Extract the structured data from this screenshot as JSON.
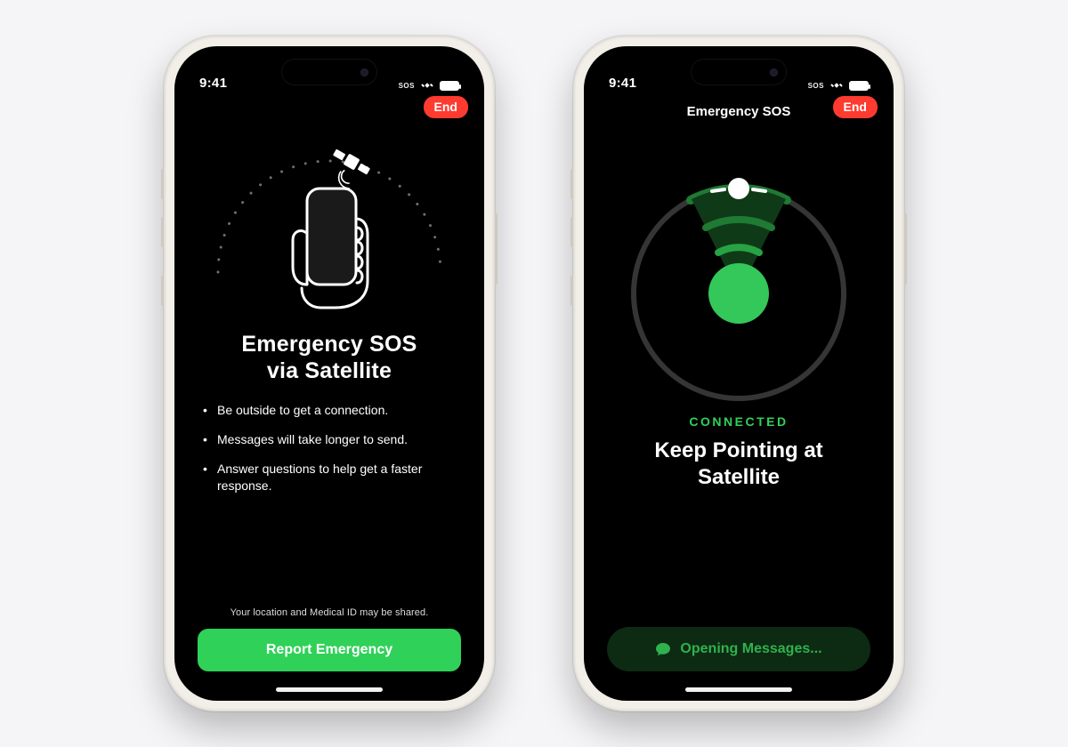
{
  "colors": {
    "accent_green": "#30d158",
    "danger_red": "#ff3b30",
    "pill_bg": "#0d2a13",
    "pill_fg": "#2fb24e"
  },
  "status_bar": {
    "time": "9:41",
    "sos_label": "SOS"
  },
  "screen1": {
    "end_label": "End",
    "title_line1": "Emergency SOS",
    "title_line2": "via Satellite",
    "bullets": [
      "Be outside to get a connection.",
      "Messages will take longer to send.",
      "Answer questions to help get a faster response."
    ],
    "disclosure": "Your location and Medical ID may be shared.",
    "primary_button": "Report Emergency"
  },
  "screen2": {
    "nav_title": "Emergency SOS",
    "end_label": "End",
    "status_heading": "CONNECTED",
    "instruction_line1": "Keep Pointing at",
    "instruction_line2": "Satellite",
    "pill_label": "Opening Messages..."
  }
}
